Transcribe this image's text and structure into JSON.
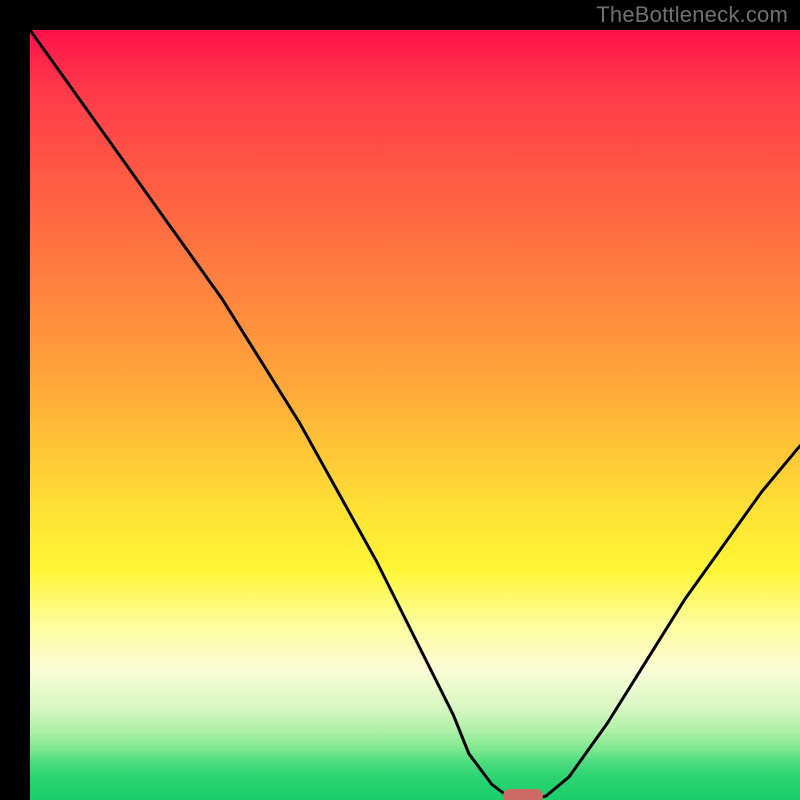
{
  "attribution": "TheBottleneck.com",
  "colors": {
    "bg": "#000000",
    "attribution_text": "#707070",
    "marker": "#cc6a66",
    "curve": "#000000",
    "gradient_top": "#ff124a",
    "gradient_bottom": "#1ace6b"
  },
  "chart_data": {
    "type": "line",
    "title": "",
    "xlabel": "",
    "ylabel": "",
    "xlim": [
      0,
      100
    ],
    "ylim": [
      0,
      100
    ],
    "x": [
      0,
      5,
      10,
      15,
      20,
      25,
      30,
      35,
      40,
      45,
      50,
      55,
      57,
      60,
      62,
      64,
      67,
      70,
      75,
      80,
      85,
      90,
      95,
      100
    ],
    "values": [
      100,
      93,
      86,
      79,
      72,
      65,
      57,
      49,
      40,
      31,
      21,
      11,
      6,
      2,
      0.5,
      0,
      0.5,
      3,
      10,
      18,
      26,
      33,
      40,
      46
    ],
    "marker_x": 64,
    "marker_y": 0.5
  }
}
